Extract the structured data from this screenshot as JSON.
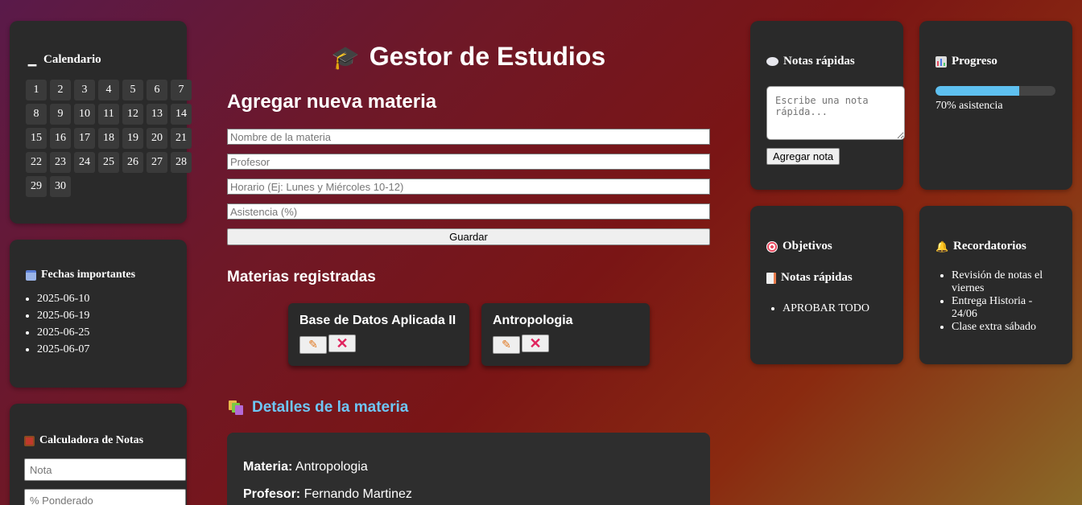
{
  "calendar": {
    "title": "Calendario",
    "days": [
      "1",
      "2",
      "3",
      "4",
      "5",
      "6",
      "7",
      "8",
      "9",
      "10",
      "11",
      "12",
      "13",
      "14",
      "15",
      "16",
      "17",
      "18",
      "19",
      "20",
      "21",
      "22",
      "23",
      "24",
      "25",
      "26",
      "27",
      "28",
      "29",
      "30"
    ]
  },
  "dates": {
    "title": "Fechas importantes",
    "items": [
      "2025-06-10",
      "2025-06-19",
      "2025-06-25",
      "2025-06-07"
    ]
  },
  "calculator": {
    "title": "Calculadora de Notas",
    "grade_placeholder": "Nota",
    "weight_placeholder": "% Ponderado"
  },
  "app": {
    "title": "Gestor de Estudios"
  },
  "add_form": {
    "heading": "Agregar nueva materia",
    "subject_placeholder": "Nombre de la materia",
    "teacher_placeholder": "Profesor",
    "schedule_placeholder": "Horario (Ej: Lunes y Miércoles 10-12)",
    "attendance_placeholder": "Asistencia (%)",
    "save_label": "Guardar"
  },
  "registered": {
    "heading": "Materias registradas",
    "subjects": [
      {
        "name": "Base de Datos Aplicada II"
      },
      {
        "name": "Antropologia"
      }
    ]
  },
  "details": {
    "heading": "Detalles de la materia",
    "subject_label": "Materia:",
    "subject_value": "Antropologia",
    "teacher_label": "Profesor:",
    "teacher_value": "Fernando Martinez"
  },
  "quick_notes": {
    "title": "Notas rápidas",
    "placeholder": "Escribe una nota rápida...",
    "add_label": "Agregar nota"
  },
  "progress": {
    "title": "Progreso",
    "value": 0.7,
    "text": "70% asistencia",
    "color": "#5ec0f0"
  },
  "objectives": {
    "title": "Objetivos",
    "subtitle": "Notas rápidas",
    "items": [
      "APROBAR TODO"
    ]
  },
  "reminders": {
    "title": "Recordatorios",
    "items": [
      "Revisión de notas el viernes",
      "Entrega Historia - 24/06",
      "Clase extra sábado"
    ]
  }
}
